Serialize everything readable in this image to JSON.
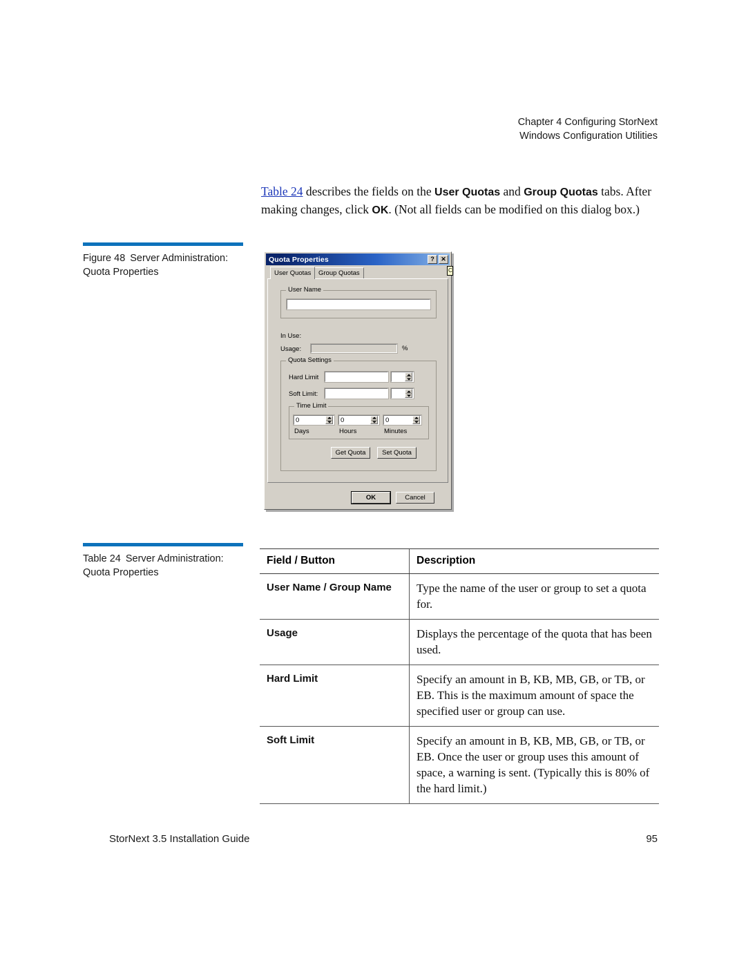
{
  "header": {
    "line1": "Chapter 4  Configuring StorNext",
    "line2": "Windows Configuration Utilities"
  },
  "intro": {
    "link_text": "Table 24",
    "part1": " describes the fields on the ",
    "bold1": "User Quotas",
    "part2": " and ",
    "bold2": "Group Quotas",
    "part3": " tabs. After making changes, click ",
    "bold3": "OK",
    "part4": ". (Not all fields can be modified on this dialog box.)"
  },
  "figure_caption": {
    "label": "Figure 48",
    "text": "Server Administration: Quota Properties"
  },
  "table_caption": {
    "label": "Table 24",
    "text": "Server Administration: Quota Properties"
  },
  "dialog": {
    "title": "Quota Properties",
    "help_button": "?",
    "close_button": "✕",
    "tooltip_sliver": "C",
    "tabs": [
      {
        "label": "User Quotas",
        "active": true
      },
      {
        "label": "Group Quotas",
        "active": false
      }
    ],
    "user_name_group": {
      "title": "User Name",
      "value": ""
    },
    "in_use_label": "In Use:",
    "usage_label": "Usage:",
    "usage_value": "",
    "percent_symbol": "%",
    "quota_settings": {
      "title": "Quota Settings",
      "hard_limit_label": "Hard Limit",
      "hard_limit_value": "",
      "hard_limit_unit_value": "",
      "soft_limit_label": "Soft Limit:",
      "soft_limit_value": "",
      "soft_limit_unit_value": "",
      "time_limit": {
        "title": "Time Limit",
        "days_value": "0",
        "days_label": "Days",
        "hours_value": "0",
        "hours_label": "Hours",
        "minutes_value": "0",
        "minutes_label": "Minutes"
      },
      "get_quota_button": "Get Quota",
      "set_quota_button": "Set Quota"
    },
    "ok_button": "OK",
    "cancel_button": "Cancel"
  },
  "table": {
    "columns": [
      "Field / Button",
      "Description"
    ],
    "rows": [
      {
        "field": "User Name / Group Name",
        "description": "Type the name of the user or group to set a quota for."
      },
      {
        "field": "Usage",
        "description": "Displays the percentage of the quota that has been used."
      },
      {
        "field": "Hard Limit",
        "description": "Specify an amount in B, KB, MB, GB, or TB, or EB. This is the maximum amount of space the specified user or group can use."
      },
      {
        "field": "Soft Limit",
        "description": "Specify an amount in B, KB, MB, GB, or TB, or EB. Once the user or group uses this amount of space, a warning is sent. (Typically this is 80% of the hard limit.)"
      }
    ]
  },
  "footer": {
    "guide": "StorNext 3.5 Installation Guide",
    "page_number": "95"
  },
  "colors": {
    "accent_rule": "#0d72bb",
    "link": "#1b36b8",
    "dialog_face": "#d4d0c8",
    "titlebar": "#0a246a"
  }
}
